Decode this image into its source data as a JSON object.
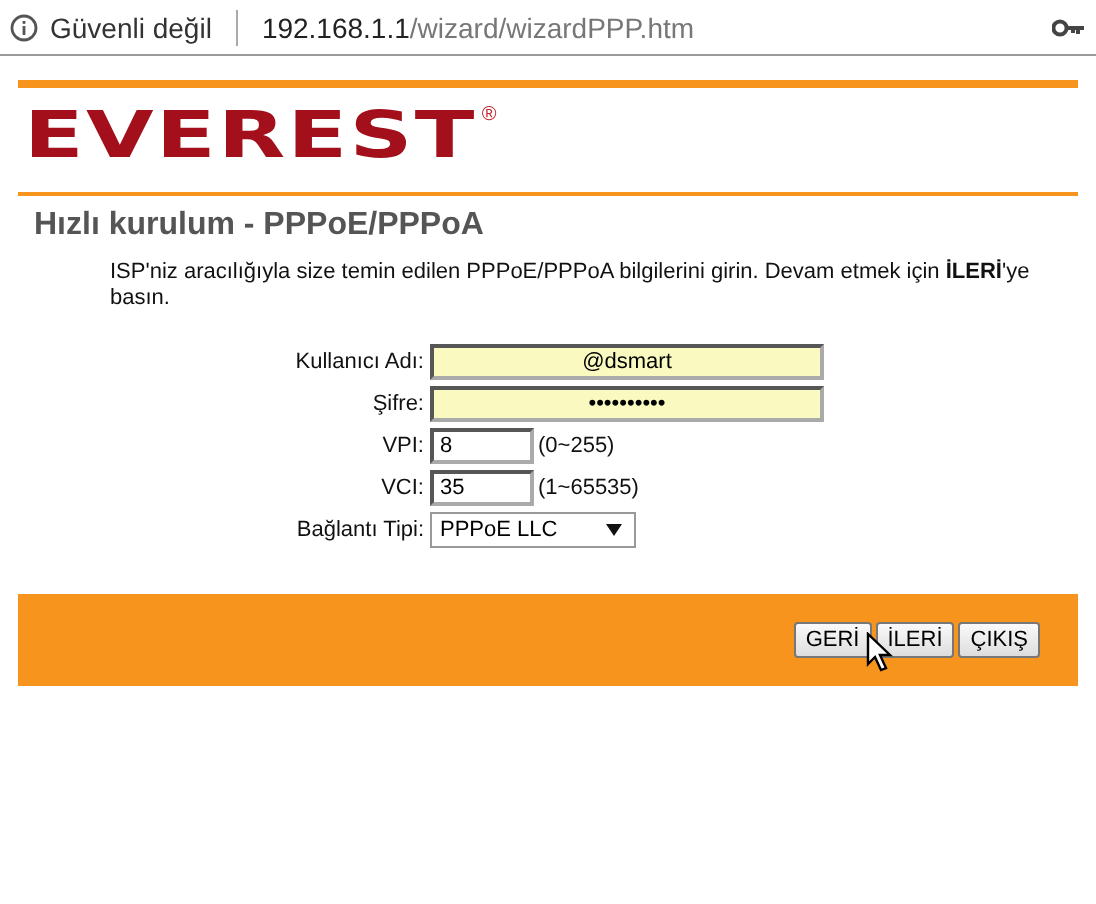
{
  "address_bar": {
    "security": "Güvenli değil",
    "host": "192.168.1.1",
    "path": "/wizard/wizardPPP.htm"
  },
  "logo": {
    "text": "EVEREST",
    "mark": "®"
  },
  "title": "Hızlı kurulum - PPPoE/PPPoA",
  "intro": "ISP'niz aracılığıyla size temin edilen PPPoE/PPPoA bilgilerini girin. Devam etmek için **İLERİ**'ye basın.",
  "fields": [
    {
      "label": "Kullanıcı Adı:",
      "kind": "wide",
      "value": "@dsmart"
    },
    {
      "label": "Şifre:",
      "kind": "wide",
      "value": "••••••••••"
    },
    {
      "label": "VPI:",
      "kind": "short",
      "value": "8",
      "hint": "(0~255)"
    },
    {
      "label": "VCI:",
      "kind": "short",
      "value": "35",
      "hint": "(1~65535)"
    },
    {
      "label": "Bağlantı Tipi:",
      "kind": "select",
      "value": "PPPoE LLC"
    }
  ],
  "buttons": [
    "GERİ",
    "İLERİ",
    "ÇIKIŞ"
  ]
}
